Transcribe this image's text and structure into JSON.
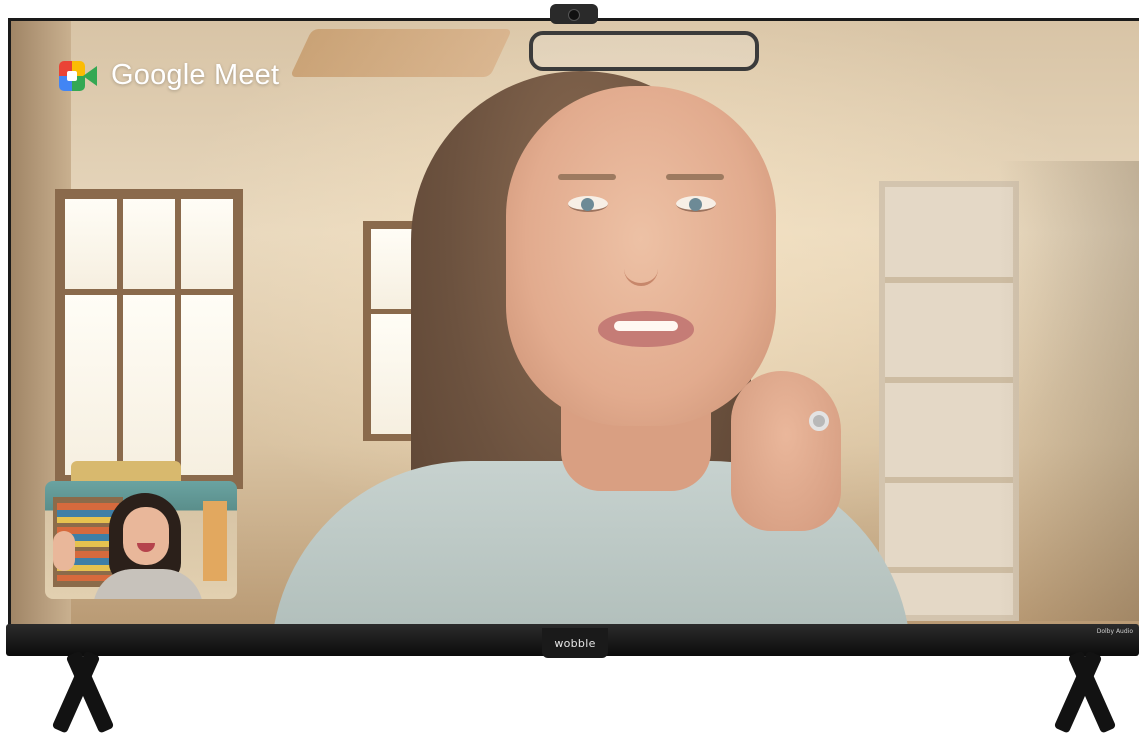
{
  "app": {
    "name": "Google Meet",
    "logo_icon": "google-meet-icon"
  },
  "tv": {
    "brand": "wobble",
    "audio_badge": "Dolby Audio"
  },
  "call": {
    "main_participant_icon": "video-feed",
    "self_view_icon": "self-view-thumbnail"
  },
  "colors": {
    "meet_red": "#ea4335",
    "meet_yellow": "#fbbc04",
    "meet_blue": "#4285f4",
    "meet_green": "#34a853",
    "bezel": "#111111"
  }
}
